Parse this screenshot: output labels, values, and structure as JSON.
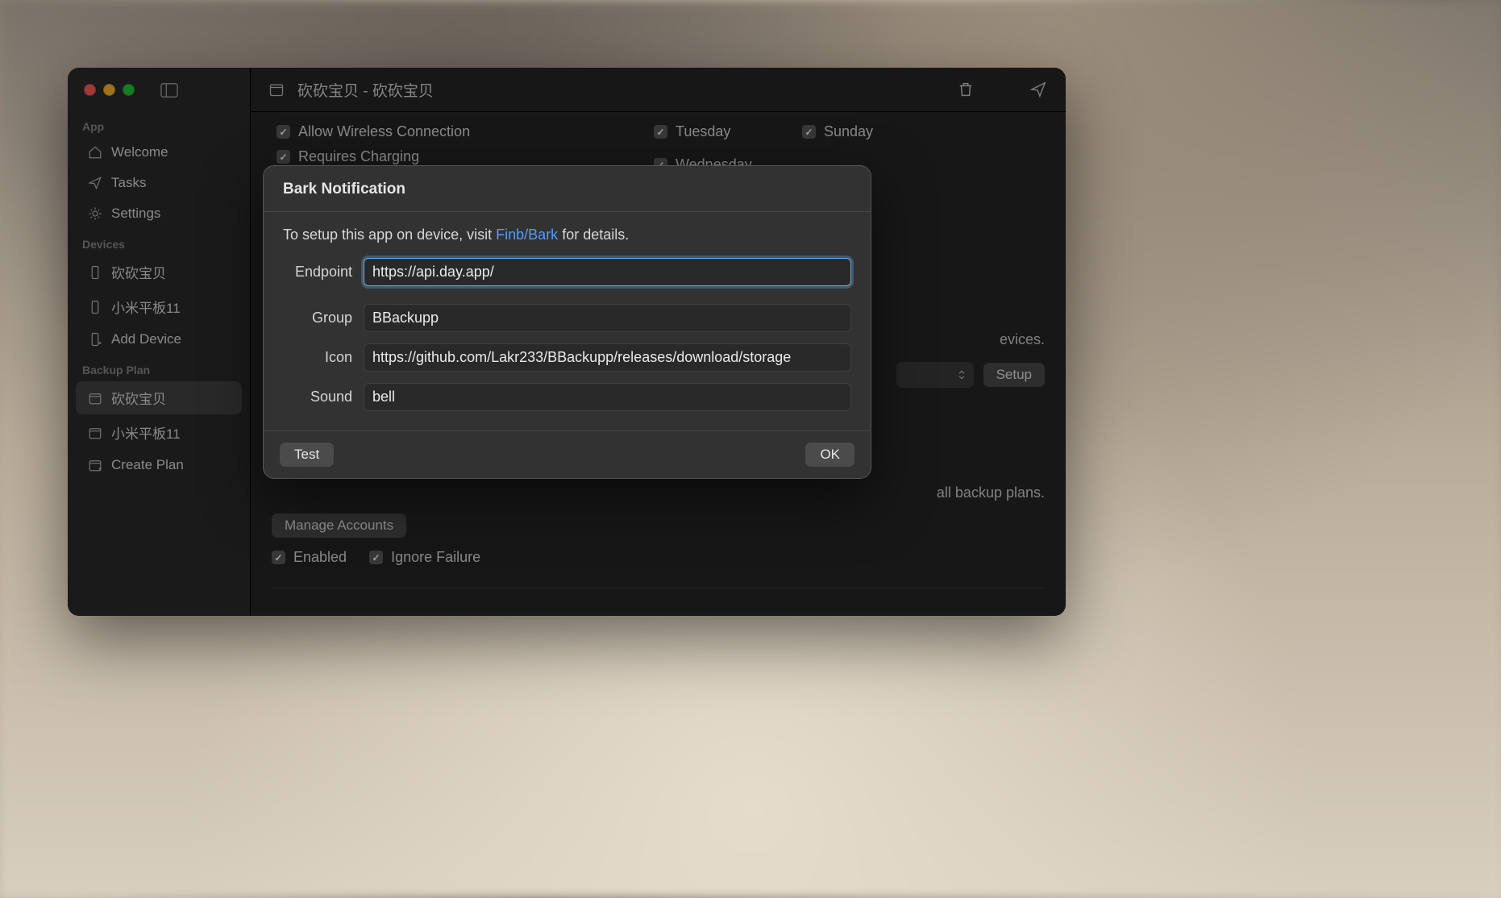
{
  "sidebar": {
    "sections": {
      "app": {
        "label": "App",
        "items": [
          {
            "label": "Welcome"
          },
          {
            "label": "Tasks"
          },
          {
            "label": "Settings"
          }
        ]
      },
      "devices": {
        "label": "Devices",
        "items": [
          {
            "label": "砍砍宝贝"
          },
          {
            "label": "小米平板11"
          },
          {
            "label": "Add Device"
          }
        ]
      },
      "backup_plan": {
        "label": "Backup Plan",
        "items": [
          {
            "label": "砍砍宝贝"
          },
          {
            "label": "小米平板11"
          },
          {
            "label": "Create Plan"
          }
        ]
      }
    }
  },
  "toolbar": {
    "title": "砍砍宝贝 - 砍砍宝贝"
  },
  "content": {
    "allow_wireless": "Allow Wireless Connection",
    "requires_charging": "Requires Charging",
    "days": {
      "tuesday": "Tuesday",
      "wednesday": "Wednesday",
      "sunday": "Sunday"
    },
    "devices_hint_suffix": "evices.",
    "setup_button": "Setup",
    "plans_hint_suffix": "all backup plans.",
    "manage_accounts": "Manage Accounts",
    "enabled": "Enabled",
    "ignore_failure": "Ignore Failure"
  },
  "modal": {
    "title": "Bark Notification",
    "desc_prefix": "To setup this app on device, visit ",
    "desc_link": "Finb/Bark",
    "desc_suffix": " for details.",
    "fields": {
      "endpoint": {
        "label": "Endpoint",
        "value": "https://api.day.app/"
      },
      "group": {
        "label": "Group",
        "value": "BBackupp"
      },
      "icon": {
        "label": "Icon",
        "value": "https://github.com/Lakr233/BBackupp/releases/download/storage"
      },
      "sound": {
        "label": "Sound",
        "value": "bell"
      }
    },
    "buttons": {
      "test": "Test",
      "ok": "OK"
    }
  }
}
